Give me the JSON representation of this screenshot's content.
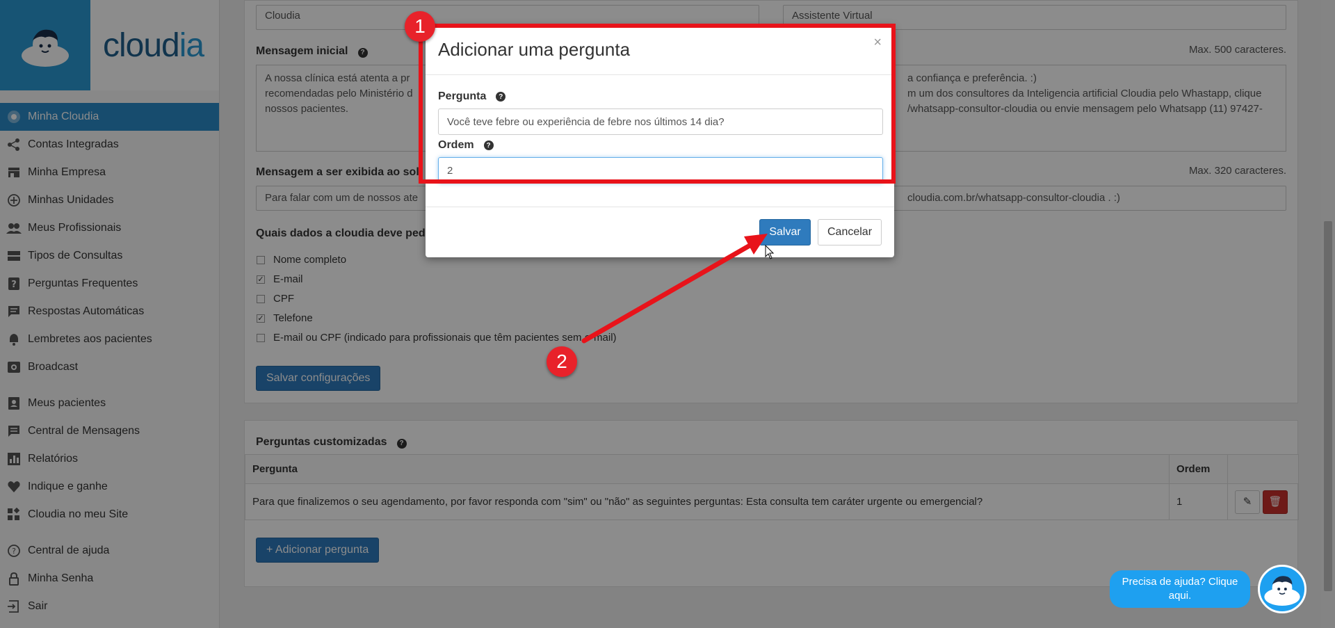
{
  "brand": {
    "name_a": "cloud",
    "name_b": "ia"
  },
  "sidebar": {
    "items": [
      {
        "label": "Minha Cloudia",
        "icon": "eye-icon"
      },
      {
        "label": "Contas Integradas",
        "icon": "share-icon"
      },
      {
        "label": "Minha Empresa",
        "icon": "store-icon"
      },
      {
        "label": "Minhas Unidades",
        "icon": "plus-circle-icon"
      },
      {
        "label": "Meus Profissionais",
        "icon": "people-icon"
      },
      {
        "label": "Tipos de Consultas",
        "icon": "list-icon"
      },
      {
        "label": "Perguntas Frequentes",
        "icon": "question-icon"
      },
      {
        "label": "Respostas Automáticas",
        "icon": "chat-icon"
      },
      {
        "label": "Lembretes aos pacientes",
        "icon": "bell-icon"
      },
      {
        "label": "Broadcast",
        "icon": "broadcast-icon"
      },
      {
        "label": "Meus pacientes",
        "icon": "contacts-icon"
      },
      {
        "label": "Central de Mensagens",
        "icon": "message-icon"
      },
      {
        "label": "Relatórios",
        "icon": "chart-icon"
      },
      {
        "label": "Indique e ganhe",
        "icon": "heart-icon"
      },
      {
        "label": "Cloudia no meu Site",
        "icon": "widgets-icon"
      },
      {
        "label": "Central de ajuda",
        "icon": "help-circle-icon"
      },
      {
        "label": "Minha Senha",
        "icon": "lock-icon"
      },
      {
        "label": "Sair",
        "icon": "logout-icon"
      }
    ]
  },
  "config": {
    "name_value": "Cloudia",
    "role_value": "Assistente Virtual",
    "initial_msg_label": "Mensagem inicial",
    "initial_msg_limit": "Max. 500 caracteres.",
    "initial_msg_left": "A nossa clínica está atenta a pr\nrecomendadas pelo Ministério d\nnossos pacientes.",
    "initial_msg_right": "a confiança e preferência. :)\nm um dos consultores da Inteligencia artificial Cloudia pelo Whastapp, clique\n/whatsapp-consultor-cloudia ou envie mensagem pelo Whatsapp (11) 97427-",
    "request_msg_label": "Mensagem a ser exibida ao sol",
    "request_msg_limit": "Max. 320 caracteres.",
    "request_msg_left": "Para falar com um de nossos ate",
    "request_msg_right": "cloudia.com.br/whatsapp-consultor-cloudia . :)",
    "data_label": "Quais dados a cloudia deve pedi",
    "checks": [
      {
        "label": "Nome completo",
        "checked": false
      },
      {
        "label": "E-mail",
        "checked": true
      },
      {
        "label": "CPF",
        "checked": false
      },
      {
        "label": "Telefone",
        "checked": true
      },
      {
        "label": "E-mail ou CPF (indicado para profissionais que têm pacientes sem e-mail)",
        "checked": false
      }
    ],
    "save_label": "Salvar configurações"
  },
  "custom_questions": {
    "title": "Perguntas customizadas",
    "col_question": "Pergunta",
    "col_order": "Ordem",
    "rows": [
      {
        "question": "Para que finalizemos o seu agendamento, por favor responda com \"sim\" ou \"não\" as seguintes perguntas: Esta consulta tem caráter urgente ou emergencial?",
        "order": "1"
      }
    ],
    "add_label": "+ Adicionar pergunta"
  },
  "modal": {
    "title": "Adicionar uma pergunta",
    "close": "×",
    "question_label": "Pergunta",
    "question_value": "Você teve febre ou experiência de febre nos últimos 14 dia?",
    "order_label": "Ordem",
    "order_value": "2",
    "save_label": "Salvar",
    "cancel_label": "Cancelar"
  },
  "annotations": {
    "badge1": "1",
    "badge2": "2"
  },
  "help_widget": {
    "text": "Precisa de ajuda? Clique aqui."
  },
  "colors": {
    "primary": "#2f7bbd",
    "highlight": "#e8131a",
    "help": "#1ea0f0"
  }
}
